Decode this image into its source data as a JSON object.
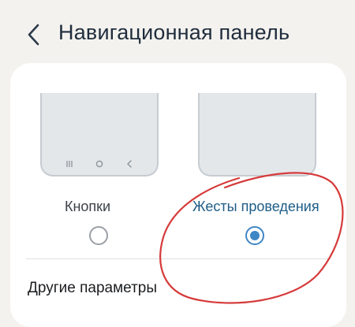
{
  "header": {
    "title": "Навигационная панель",
    "back_icon": "chevron-left-icon"
  },
  "options": [
    {
      "label": "Кнопки",
      "selected": false
    },
    {
      "label": "Жесты проведения",
      "selected": true
    }
  ],
  "footer": {
    "other_settings_label": "Другие параметры"
  },
  "colors": {
    "background": "#f4f2ee",
    "accent": "#3f86c5",
    "selected_label": "#1e5c87",
    "annotation_marker": "#d63a3a"
  }
}
